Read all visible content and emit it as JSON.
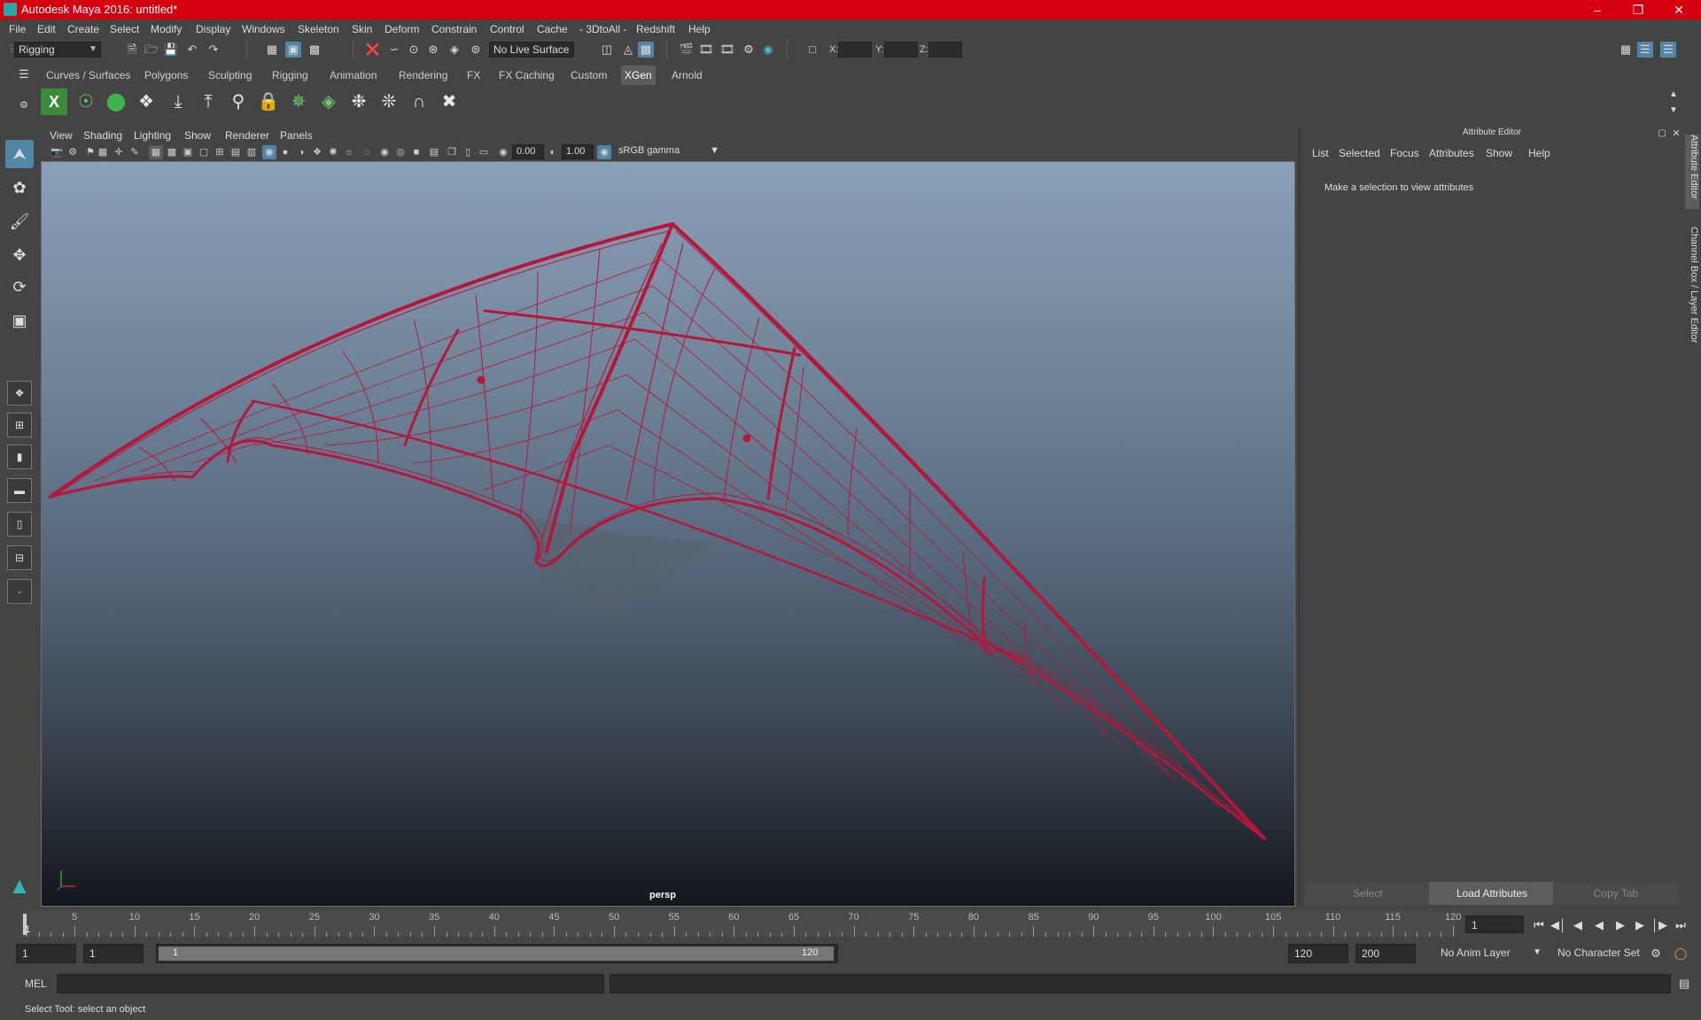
{
  "titlebar": {
    "title": "Autodesk Maya 2016: untitled*"
  },
  "menu": [
    "File",
    "Edit",
    "Create",
    "Select",
    "Modify",
    "Display",
    "Windows",
    "Skeleton",
    "Skin",
    "Deform",
    "Constrain",
    "Control",
    "Cache",
    "- 3DtoAll -",
    "Redshift",
    "Help"
  ],
  "status": {
    "menuset": "Rigging",
    "live_surface": "No Live Surface",
    "x_label": "X:",
    "y_label": "Y:",
    "z_label": "Z:"
  },
  "shelf_tabs": [
    "Curves / Surfaces",
    "Polygons",
    "Sculpting",
    "Rigging",
    "Animation",
    "Rendering",
    "FX",
    "FX Caching",
    "Custom",
    "XGen",
    "Arnold"
  ],
  "shelf_active": "XGen",
  "panel_menu": [
    "View",
    "Shading",
    "Lighting",
    "Show",
    "Renderer",
    "Panels"
  ],
  "panel_toolbar": {
    "exposure": "0.00",
    "gamma": "1.00",
    "color_space": "sRGB gamma"
  },
  "viewport": {
    "camera": "persp",
    "wire_color": "#b5163c"
  },
  "attribute_editor": {
    "title": "Attribute Editor",
    "menu": [
      "List",
      "Selected",
      "Focus",
      "Attributes",
      "Show",
      "Help"
    ],
    "hint": "Make a selection to view attributes",
    "buttons": [
      "Select",
      "Load Attributes",
      "Copy Tab"
    ]
  },
  "side_tabs": [
    "Attribute Editor",
    "Channel Box / Layer Editor"
  ],
  "timeslider": {
    "ticks": [
      "5",
      "10",
      "15",
      "20",
      "25",
      "30",
      "35",
      "40",
      "45",
      "50",
      "55",
      "60",
      "65",
      "70",
      "75",
      "80",
      "85",
      "90",
      "95",
      "100",
      "105",
      "110",
      "115",
      "120"
    ],
    "current": "1",
    "current_field": "1"
  },
  "range": {
    "start": "1",
    "range_start": "1",
    "slider_start": "1",
    "slider_end": "120",
    "end": "120",
    "anim_end": "200",
    "anim_layer": "No Anim Layer",
    "char_set": "No Character Set"
  },
  "cmd": {
    "label": "MEL"
  },
  "help": {
    "text": "Select Tool: select an object"
  }
}
